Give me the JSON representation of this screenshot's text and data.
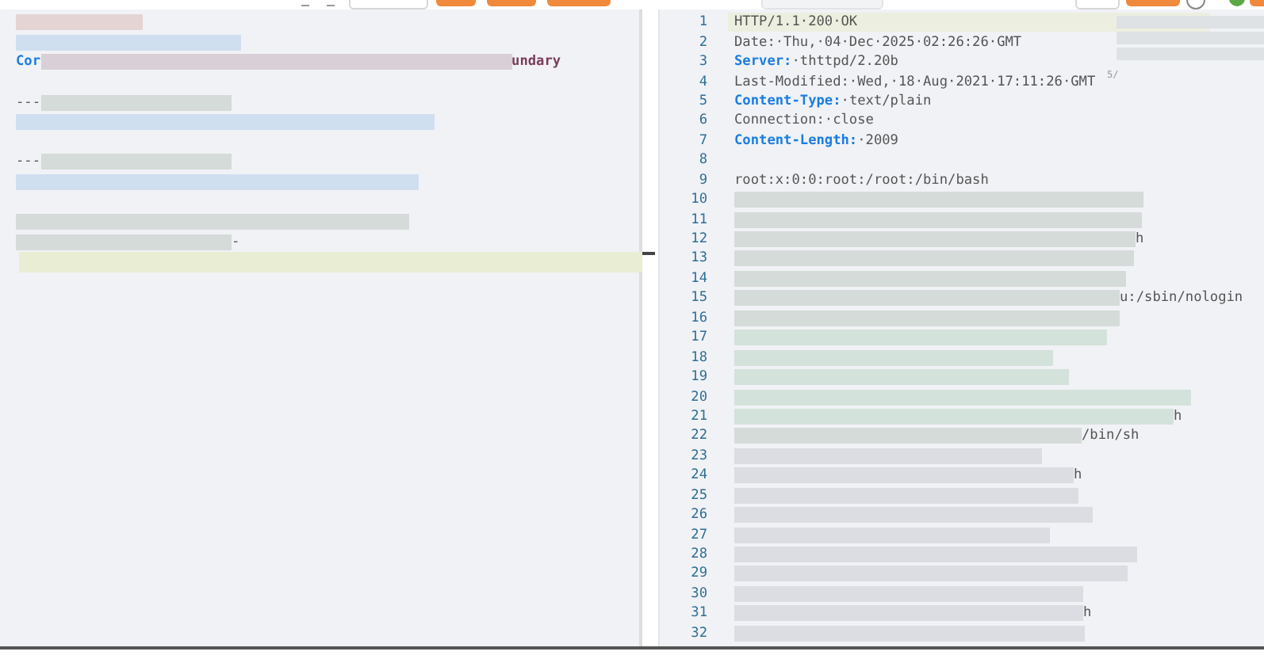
{
  "toolbar": {
    "left_controls": [
      {
        "kind": "arrow"
      },
      {
        "kind": "arrow"
      },
      {
        "kind": "outline"
      },
      {
        "kind": "primary"
      },
      {
        "kind": "primary"
      },
      {
        "kind": "primary"
      }
    ],
    "right_controls": [
      {
        "kind": "pill"
      },
      {
        "kind": "outline"
      },
      {
        "kind": "primary"
      },
      {
        "kind": "search"
      },
      {
        "kind": "round"
      },
      {
        "kind": "primary"
      }
    ]
  },
  "request": {
    "lines": [
      {
        "current": false,
        "segments": [
          {
            "kind": "redacted",
            "color": "#e4d4d4"
          }
        ]
      },
      {
        "current": false,
        "segments": [
          {
            "kind": "redacted",
            "color": "#cfdff0"
          }
        ]
      },
      {
        "current": false,
        "segments": [
          {
            "kind": "key",
            "text": "Cor"
          },
          {
            "kind": "redacted",
            "color": "#d9cfd6"
          },
          {
            "kind": "value",
            "text": "undary"
          }
        ]
      },
      {
        "current": false
      },
      {
        "current": false,
        "segments": [
          {
            "kind": "plain",
            "text": "---"
          },
          {
            "kind": "redacted",
            "color": "#d5dbd8"
          }
        ]
      },
      {
        "current": false,
        "segments": [
          {
            "kind": "redacted",
            "color": "#cfdff0"
          }
        ]
      },
      {
        "current": false
      },
      {
        "current": false,
        "segments": [
          {
            "kind": "plain",
            "text": "---"
          },
          {
            "kind": "redacted",
            "color": "#d5dbd8"
          }
        ]
      },
      {
        "current": false,
        "segments": [
          {
            "kind": "redacted",
            "color": "#cfdff0"
          }
        ]
      },
      {
        "current": false
      },
      {
        "current": false,
        "segments": [
          {
            "kind": "redacted",
            "color": "#d5dbd8"
          }
        ]
      },
      {
        "current": false,
        "segments": [
          {
            "kind": "redacted",
            "color": "#d5dbd8"
          },
          {
            "kind": "plain",
            "text": "-"
          }
        ]
      },
      {
        "current": true
      }
    ]
  },
  "response": {
    "side_note": "5/",
    "lines": [
      {
        "number": "1",
        "current": true,
        "segments": [
          {
            "kind": "plain",
            "text": "HTTP/1.1·200·OK"
          }
        ]
      },
      {
        "number": "2",
        "current": false,
        "segments": [
          {
            "kind": "plain",
            "text": "Date:·Thu,·04·Dec·2025·02:26:26·GMT"
          }
        ]
      },
      {
        "number": "3",
        "current": false,
        "segments": [
          {
            "kind": "key",
            "text": "Server:"
          },
          {
            "kind": "plain",
            "text": "·thttpd/2.20b"
          }
        ]
      },
      {
        "number": "4",
        "current": false,
        "segments": [
          {
            "kind": "plain",
            "text": "Last-Modified:·Wed,·18·Aug·2021·17:11:26·GMT"
          }
        ]
      },
      {
        "number": "5",
        "current": false,
        "segments": [
          {
            "kind": "key",
            "text": "Content-Type:"
          },
          {
            "kind": "plain",
            "text": "·text/plain"
          }
        ]
      },
      {
        "number": "6",
        "current": false,
        "segments": [
          {
            "kind": "plain",
            "text": "Connection:·close"
          }
        ]
      },
      {
        "number": "7",
        "current": false,
        "segments": [
          {
            "kind": "key",
            "text": "Content-Length:"
          },
          {
            "kind": "plain",
            "text": "·2009"
          }
        ]
      },
      {
        "number": "8",
        "current": false
      },
      {
        "number": "9",
        "current": false,
        "segments": [
          {
            "kind": "plain",
            "text": "root:x:0:0:root:/root:/bin/bash"
          }
        ]
      },
      {
        "number": "10",
        "current": false,
        "segments": [
          {
            "kind": "redacted",
            "color": "#d5dbd8"
          }
        ]
      },
      {
        "number": "11",
        "current": false,
        "segments": [
          {
            "kind": "redacted",
            "color": "#d5dbd8"
          }
        ]
      },
      {
        "number": "12",
        "current": false,
        "segments": [
          {
            "kind": "redacted",
            "color": "#d5dbd8"
          },
          {
            "kind": "plain",
            "text": "h"
          }
        ]
      },
      {
        "number": "13",
        "current": false,
        "segments": [
          {
            "kind": "redacted",
            "color": "#d5dbd8"
          }
        ]
      },
      {
        "number": "14",
        "current": false,
        "segments": [
          {
            "kind": "redacted",
            "color": "#d5dbd8"
          }
        ]
      },
      {
        "number": "15",
        "current": false,
        "segments": [
          {
            "kind": "redacted",
            "color": "#d5dbd8"
          },
          {
            "kind": "plain",
            "text": "u:/sbin/nologin"
          }
        ]
      },
      {
        "number": "16",
        "current": false,
        "segments": [
          {
            "kind": "redacted",
            "color": "#d5dbd8"
          }
        ]
      },
      {
        "number": "17",
        "current": false,
        "segments": [
          {
            "kind": "redacted",
            "color": "#d3e2da"
          }
        ]
      },
      {
        "number": "18",
        "current": false,
        "segments": [
          {
            "kind": "redacted",
            "color": "#d3e2da"
          }
        ]
      },
      {
        "number": "19",
        "current": false,
        "segments": [
          {
            "kind": "redacted",
            "color": "#d3e2da"
          }
        ]
      },
      {
        "number": "20",
        "current": false,
        "segments": [
          {
            "kind": "redacted",
            "color": "#d3e2da"
          }
        ]
      },
      {
        "number": "21",
        "current": false,
        "segments": [
          {
            "kind": "redacted",
            "color": "#d3e2da"
          },
          {
            "kind": "plain",
            "text": "h"
          }
        ]
      },
      {
        "number": "22",
        "current": false,
        "segments": [
          {
            "kind": "redacted",
            "color": "#d5dbd8"
          },
          {
            "kind": "plain",
            "text": "/bin/sh"
          }
        ]
      },
      {
        "number": "23",
        "current": false,
        "segments": [
          {
            "kind": "redacted",
            "color": "#dcdde2"
          }
        ]
      },
      {
        "number": "24",
        "current": false,
        "segments": [
          {
            "kind": "redacted",
            "color": "#dcdde2"
          },
          {
            "kind": "plain",
            "text": "h"
          }
        ]
      },
      {
        "number": "25",
        "current": false,
        "segments": [
          {
            "kind": "redacted",
            "color": "#dcdde2"
          }
        ]
      },
      {
        "number": "26",
        "current": false,
        "segments": [
          {
            "kind": "redacted",
            "color": "#dcdde2"
          }
        ]
      },
      {
        "number": "27",
        "current": false,
        "segments": [
          {
            "kind": "redacted",
            "color": "#dcdde2"
          }
        ]
      },
      {
        "number": "28",
        "current": false,
        "segments": [
          {
            "kind": "redacted",
            "color": "#dcdde2"
          }
        ]
      },
      {
        "number": "29",
        "current": false,
        "segments": [
          {
            "kind": "redacted",
            "color": "#dcdde2"
          }
        ]
      },
      {
        "number": "30",
        "current": false,
        "segments": [
          {
            "kind": "redacted",
            "color": "#dcdde2"
          }
        ]
      },
      {
        "number": "31",
        "current": false,
        "segments": [
          {
            "kind": "redacted",
            "color": "#dcdde2"
          },
          {
            "kind": "plain",
            "text": "h"
          }
        ]
      },
      {
        "number": "32",
        "current": false,
        "segments": [
          {
            "kind": "redacted",
            "color": "#dcdde2"
          }
        ]
      }
    ]
  }
}
